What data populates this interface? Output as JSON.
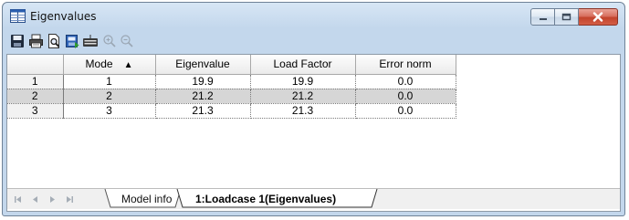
{
  "window": {
    "title": "Eigenvalues",
    "controls": [
      "minimize",
      "maximize",
      "close"
    ]
  },
  "toolbar": {
    "buttons": [
      {
        "icon": "save-icon",
        "enabled": true
      },
      {
        "icon": "print-icon",
        "enabled": true
      },
      {
        "icon": "print-preview-icon",
        "enabled": true
      },
      {
        "icon": "export-icon",
        "enabled": true
      },
      {
        "icon": "keyboard-icon",
        "enabled": true
      },
      {
        "icon": "zoom-in-icon",
        "enabled": false
      },
      {
        "icon": "zoom-out-icon",
        "enabled": false
      }
    ]
  },
  "table": {
    "columns": [
      "Mode",
      "Eigenvalue",
      "Load Factor",
      "Error norm"
    ],
    "sort_indicator": "▲",
    "rows": [
      {
        "num": "1",
        "mode": "1",
        "eigenvalue": "19.9",
        "load_factor": "19.9",
        "error_norm": "0.0"
      },
      {
        "num": "2",
        "mode": "2",
        "eigenvalue": "21.2",
        "load_factor": "21.2",
        "error_norm": "0.0"
      },
      {
        "num": "3",
        "mode": "3",
        "eigenvalue": "21.3",
        "load_factor": "21.3",
        "error_norm": "0.0"
      }
    ],
    "selected_row": "2"
  },
  "tabs": {
    "items": [
      "Model info",
      "1:Loadcase 1(Eigenvalues)"
    ],
    "active": "1:Loadcase 1(Eigenvalues)"
  },
  "colors": {
    "selected_row": "#d6d6d6",
    "close_button": "#c7442e",
    "title_bar": "#c3d7ec"
  }
}
